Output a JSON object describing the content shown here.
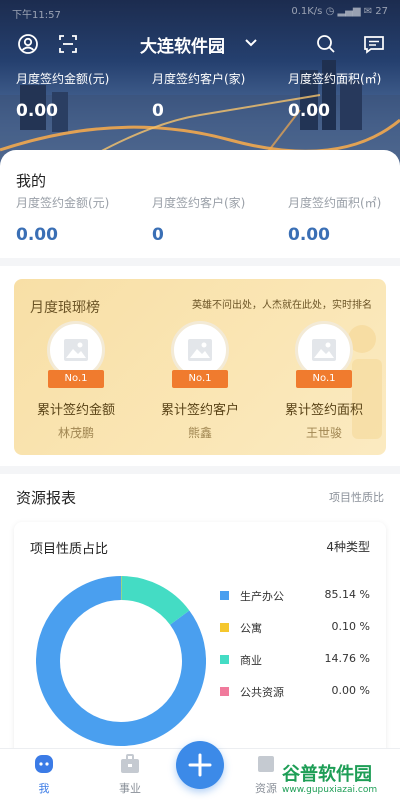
{
  "status": {
    "left": "下午11:57",
    "right": "0.1K/s ◷ ▂▄▆ ✉ 27"
  },
  "header": {
    "title": "大连软件园"
  },
  "hero_stats": [
    {
      "label": "月度签约金额(元)",
      "value": "0.00"
    },
    {
      "label": "月度签约客户(家)",
      "value": "0"
    },
    {
      "label": "月度签约面积(㎡)",
      "value": "0.00"
    }
  ],
  "mine": {
    "title": "我的",
    "stats": [
      {
        "label": "月度签约金额(元)",
        "value": "0.00"
      },
      {
        "label": "月度签约客户(家)",
        "value": "0"
      },
      {
        "label": "月度签约面积(㎡)",
        "value": "0.00"
      }
    ]
  },
  "ranking": {
    "title": "月度琅琊榜",
    "slogan": "英雄不问出处，人杰就在此处，实时排名",
    "items": [
      {
        "badge": "No.1",
        "label": "累计签约金额",
        "name": "林茂鹏"
      },
      {
        "badge": "No.1",
        "label": "累计签约客户",
        "name": "熊鑫"
      },
      {
        "badge": "No.1",
        "label": "累计签约面积",
        "name": "王世骏"
      }
    ]
  },
  "resources": {
    "title": "资源报表",
    "link": "项目性质比",
    "card_title": "项目性质占比",
    "type_count": "4种类型",
    "legend": [
      {
        "name": "生产办公",
        "percent": "85.14 %",
        "color": "#4a9fef"
      },
      {
        "name": "公寓",
        "percent": "0.10 %",
        "color": "#f5c72e"
      },
      {
        "name": "商业",
        "percent": "14.76 %",
        "color": "#44dcc4"
      },
      {
        "name": "公共资源",
        "percent": "0.00 %",
        "color": "#f07a9c"
      }
    ]
  },
  "chart_data": {
    "type": "pie",
    "title": "项目性质占比",
    "categories": [
      "生产办公",
      "公寓",
      "商业",
      "公共资源"
    ],
    "values": [
      85.14,
      0.1,
      14.76,
      0.0
    ],
    "colors": [
      "#4a9fef",
      "#f5c72e",
      "#44dcc4",
      "#f07a9c"
    ]
  },
  "nav": {
    "tabs": [
      {
        "label": "我",
        "active": true
      },
      {
        "label": "事业",
        "active": false
      },
      {
        "label": "资源",
        "active": false
      }
    ]
  },
  "watermark": {
    "line1": "谷普软件园",
    "line2": "www.gupuxiazai.com"
  }
}
